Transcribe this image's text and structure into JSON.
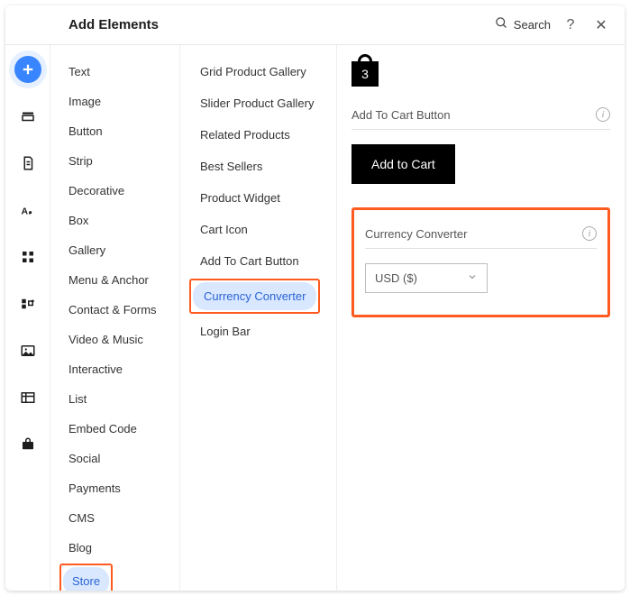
{
  "header": {
    "title": "Add Elements",
    "search_label": "Search",
    "help_label": "?",
    "close_label": "✕"
  },
  "categories": [
    {
      "label": "Text"
    },
    {
      "label": "Image"
    },
    {
      "label": "Button"
    },
    {
      "label": "Strip"
    },
    {
      "label": "Decorative"
    },
    {
      "label": "Box"
    },
    {
      "label": "Gallery"
    },
    {
      "label": "Menu & Anchor"
    },
    {
      "label": "Contact & Forms"
    },
    {
      "label": "Video & Music"
    },
    {
      "label": "Interactive"
    },
    {
      "label": "List"
    },
    {
      "label": "Embed Code"
    },
    {
      "label": "Social"
    },
    {
      "label": "Payments"
    },
    {
      "label": "CMS"
    },
    {
      "label": "Blog"
    },
    {
      "label": "Store",
      "selected": true,
      "highlighted": true
    }
  ],
  "sub_elements": [
    {
      "label": "Grid Product Gallery"
    },
    {
      "label": "Slider Product Gallery"
    },
    {
      "label": "Related Products"
    },
    {
      "label": "Best Sellers"
    },
    {
      "label": "Product Widget"
    },
    {
      "label": "Cart Icon"
    },
    {
      "label": "Add To Cart Button"
    },
    {
      "label": "Currency Converter",
      "selected": true,
      "highlighted": true
    },
    {
      "label": "Login Bar"
    }
  ],
  "preview": {
    "cart_count": "3",
    "section_addcart_label": "Add To Cart Button",
    "add_to_cart_button": "Add to Cart",
    "section_currency_label": "Currency Converter",
    "currency_value": "USD ($)"
  }
}
